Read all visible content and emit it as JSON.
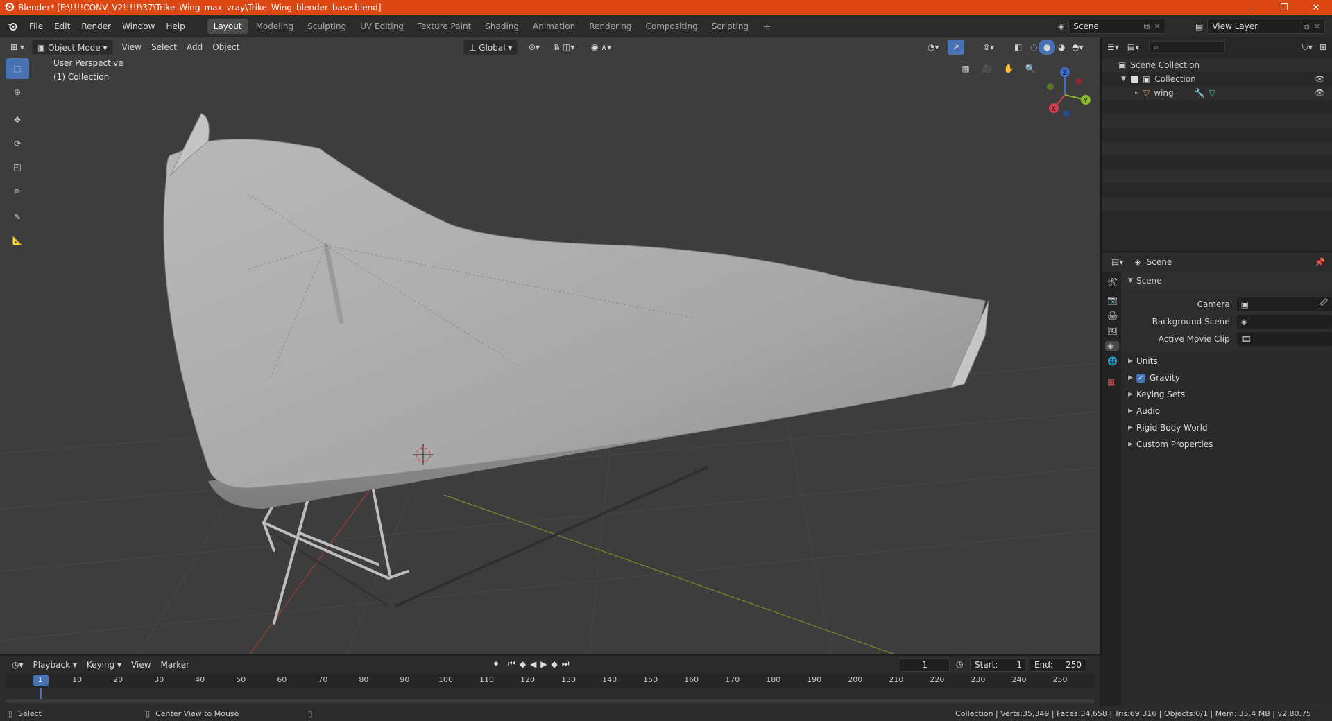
{
  "window": {
    "title": "Blender* [F:\\!!!!CONV_V2!!!!!\\37\\Trike_Wing_max_vray\\Trike_Wing_blender_base.blend]",
    "minimize": "–",
    "maximize": "❐",
    "close": "✕"
  },
  "menus": [
    "File",
    "Edit",
    "Render",
    "Window",
    "Help"
  ],
  "workspaces": [
    {
      "label": "Layout",
      "active": true
    },
    {
      "label": "Modeling"
    },
    {
      "label": "Sculpting"
    },
    {
      "label": "UV Editing"
    },
    {
      "label": "Texture Paint"
    },
    {
      "label": "Shading"
    },
    {
      "label": "Animation"
    },
    {
      "label": "Rendering"
    },
    {
      "label": "Compositing"
    },
    {
      "label": "Scripting"
    }
  ],
  "add_workspace": "+",
  "scene_selector": {
    "value": "Scene"
  },
  "view_layer_selector": {
    "value": "View Layer"
  },
  "viewport_header": {
    "mode": "Object Mode",
    "menus": [
      "View",
      "Select",
      "Add",
      "Object"
    ],
    "orientation": "Global"
  },
  "viewport": {
    "perspective": "User Perspective",
    "collection": "(1) Collection",
    "gizmo": {
      "x": "X",
      "y": "Y",
      "z": "Z"
    }
  },
  "outliner": {
    "search_placeholder": "",
    "scene_collection": "Scene Collection",
    "collection": "Collection",
    "object": "wing"
  },
  "properties": {
    "header": "Scene",
    "panel": "Scene",
    "fields": [
      {
        "label": "Camera",
        "value": ""
      },
      {
        "label": "Background Scene",
        "value": ""
      },
      {
        "label": "Active Movie Clip",
        "value": ""
      }
    ],
    "subpanels": [
      {
        "label": "Units",
        "checkbox": false
      },
      {
        "label": "Gravity",
        "checkbox": true
      },
      {
        "label": "Keying Sets",
        "checkbox": false
      },
      {
        "label": "Audio",
        "checkbox": false
      },
      {
        "label": "Rigid Body World",
        "checkbox": false
      },
      {
        "label": "Custom Properties",
        "checkbox": false
      }
    ]
  },
  "timeline": {
    "menus": [
      "Playback",
      "Keying",
      "View",
      "Marker"
    ],
    "current_frame": "1",
    "start_label": "Start:",
    "start": "1",
    "end_label": "End:",
    "end": "250",
    "ticks": [
      "1",
      "10",
      "20",
      "30",
      "40",
      "50",
      "60",
      "70",
      "80",
      "90",
      "100",
      "110",
      "120",
      "130",
      "140",
      "150",
      "160",
      "170",
      "180",
      "190",
      "200",
      "210",
      "220",
      "230",
      "240",
      "250"
    ]
  },
  "statusbar": {
    "select": "Select",
    "center_view": "Center View to Mouse",
    "stats": "Collection | Verts:35,349 | Faces:34,658 | Tris:69,316 | Objects:0/1 | Mem: 35.4 MB | v2.80.75"
  },
  "colors": {
    "title_bar": "#dd4713",
    "accent": "#4772b3",
    "viewport_bg": "#3d3d3d"
  }
}
